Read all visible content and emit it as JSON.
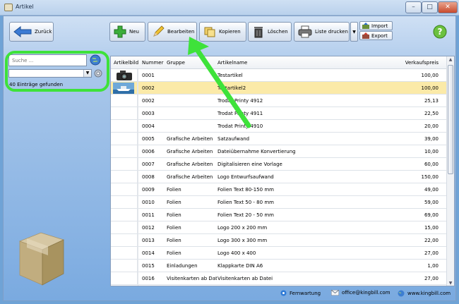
{
  "window": {
    "title": "Artikel",
    "min": "–",
    "max": "□",
    "close": "✕"
  },
  "toolbar": {
    "back_label": "Zurück",
    "new_label": "Neu",
    "edit_label": "Bearbeiten",
    "copy_label": "Kopieren",
    "delete_label": "Löschen",
    "print_label": "Liste drucken",
    "import_label": "Import",
    "export_label": "Export"
  },
  "search": {
    "placeholder": "Suche ...",
    "count": "40 Einträge gefunden"
  },
  "table": {
    "columns": [
      "Artikelbild",
      "Nummer",
      "Gruppe",
      "Artikelname",
      "Verkaufspreis"
    ],
    "rows": [
      {
        "nr": "0001",
        "group": "",
        "name": "Testartikel",
        "price": "100,00",
        "img": "camera"
      },
      {
        "nr": "0002",
        "group": "",
        "name": "Testartikel2",
        "price": "100,00",
        "img": "boat"
      },
      {
        "nr": "0002",
        "group": "",
        "name": "Trodat Printy 4912",
        "price": "25,13",
        "img": ""
      },
      {
        "nr": "0003",
        "group": "",
        "name": "Trodat Printy 4911",
        "price": "22,50",
        "img": ""
      },
      {
        "nr": "0004",
        "group": "",
        "name": "Trodat Printy 4910",
        "price": "20,00",
        "img": ""
      },
      {
        "nr": "0005",
        "group": "Grafische Arbeiten",
        "name": "Satzaufwand",
        "price": "39,00",
        "img": ""
      },
      {
        "nr": "0006",
        "group": "Grafische Arbeiten",
        "name": "Dateiübernahme Konvertierung",
        "price": "10,00",
        "img": ""
      },
      {
        "nr": "0007",
        "group": "Grafische Arbeiten",
        "name": "Digitalisieren eine Vorlage",
        "price": "60,00",
        "img": ""
      },
      {
        "nr": "0008",
        "group": "Grafische Arbeiten",
        "name": "Logo Entwurfsaufwand",
        "price": "150,00",
        "img": ""
      },
      {
        "nr": "0009",
        "group": "Folien",
        "name": "Folien Text 80-150 mm",
        "price": "49,00",
        "img": ""
      },
      {
        "nr": "0010",
        "group": "Folien",
        "name": "Folien Text 50 - 80 mm",
        "price": "59,00",
        "img": ""
      },
      {
        "nr": "0011",
        "group": "Folien",
        "name": "Folien Text 20 - 50 mm",
        "price": "69,00",
        "img": ""
      },
      {
        "nr": "0012",
        "group": "Folien",
        "name": "Logo 200 x 200 mm",
        "price": "15,00",
        "img": ""
      },
      {
        "nr": "0013",
        "group": "Folien",
        "name": "Logo 300 x 300 mm",
        "price": "22,00",
        "img": ""
      },
      {
        "nr": "0014",
        "group": "Folien",
        "name": "Logo 400 x 400",
        "price": "27,00",
        "img": ""
      },
      {
        "nr": "0015",
        "group": "Einladungen",
        "name": "Klappkarte DIN A6",
        "price": "1,00",
        "img": ""
      },
      {
        "nr": "0016",
        "group": "Visitenkarten ab Dat",
        "name": "Visitenkarten ab Datei",
        "price": "27,00",
        "img": ""
      }
    ],
    "selected_index": 1
  },
  "status": {
    "remote": "Fernwartung",
    "email": "office@kingbill.com",
    "web": "www.kingbill.com"
  },
  "colors": {
    "annotation": "#3ee23a",
    "selected_row": "#fbeaa8"
  }
}
